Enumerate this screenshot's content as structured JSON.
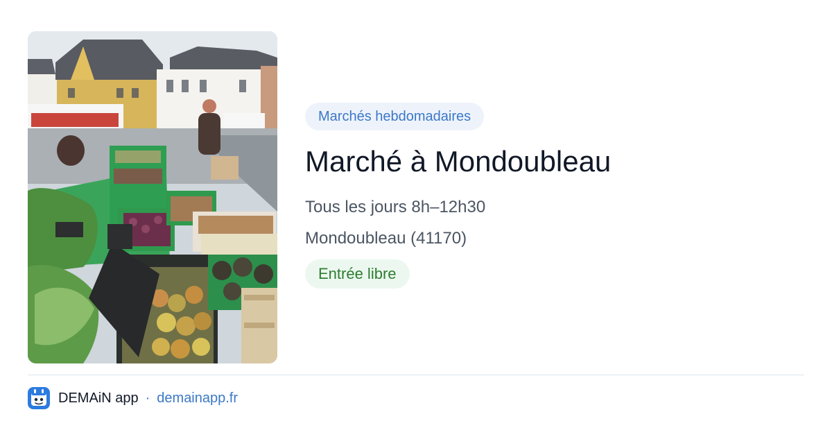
{
  "image": {
    "alt": "Étals de fruits et légumes sur la place du marché de Mondoubleau"
  },
  "event": {
    "category": "Marchés hebdomadaires",
    "title": "Marché à Mondoubleau",
    "schedule": "Tous les jours 8h–12h30",
    "location": "Mondoubleau (41170)",
    "access": "Entrée libre"
  },
  "footer": {
    "app_name": "DEMAiN app",
    "separator": "·",
    "domain": "demainapp.fr"
  },
  "colors": {
    "accent_blue": "#3b78c7",
    "badge_blue_bg": "#eef3fb",
    "green_text": "#2e7d32",
    "badge_green_bg": "#ecf8ef",
    "title_text": "#111827",
    "body_text": "#4b5563"
  },
  "icons": {
    "app_logo": "demain-logo-icon"
  }
}
